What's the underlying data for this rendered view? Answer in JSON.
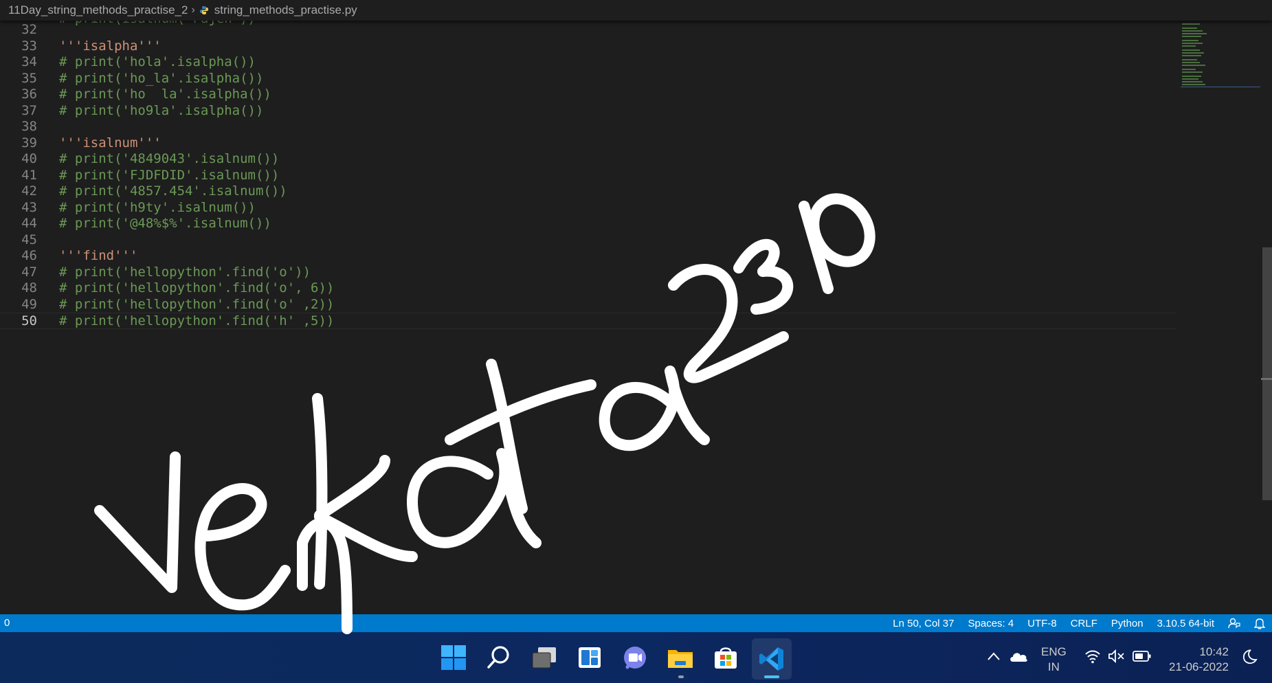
{
  "breadcrumb": {
    "folder": "11Day_string_methods_practise_2",
    "file": "string_methods_practise.py"
  },
  "editor": {
    "partial_line": "# print(isalnum(\"Fajeh\"))",
    "lines": [
      {
        "num": "32",
        "text": "",
        "kind": "plain"
      },
      {
        "num": "33",
        "text": "'''isalpha'''",
        "kind": "docstr"
      },
      {
        "num": "34",
        "text": "# print('hola'.isalpha())",
        "kind": "comment"
      },
      {
        "num": "35",
        "text": "# print('ho_la'.isalpha())",
        "kind": "comment"
      },
      {
        "num": "36",
        "text": "# print('ho  la'.isalpha())",
        "kind": "comment"
      },
      {
        "num": "37",
        "text": "# print('ho9la'.isalpha())",
        "kind": "comment"
      },
      {
        "num": "38",
        "text": "",
        "kind": "plain"
      },
      {
        "num": "39",
        "text": "'''isalnum'''",
        "kind": "docstr"
      },
      {
        "num": "40",
        "text": "# print('4849043'.isalnum())",
        "kind": "comment"
      },
      {
        "num": "41",
        "text": "# print('FJDFDID'.isalnum())",
        "kind": "comment"
      },
      {
        "num": "42",
        "text": "# print('4857.454'.isalnum())",
        "kind": "comment"
      },
      {
        "num": "43",
        "text": "# print('h9ty'.isalnum())",
        "kind": "comment"
      },
      {
        "num": "44",
        "text": "# print('@48%$%'.isalnum())",
        "kind": "comment"
      },
      {
        "num": "45",
        "text": "",
        "kind": "plain"
      },
      {
        "num": "46",
        "text": "'''find'''",
        "kind": "docstr"
      },
      {
        "num": "47",
        "text": "# print('hellopython'.find('o'))",
        "kind": "comment"
      },
      {
        "num": "48",
        "text": "# print('hellopython'.find('o', 6))",
        "kind": "comment"
      },
      {
        "num": "49",
        "text": "# print('hellopython'.find('o' ,2))",
        "kind": "comment"
      },
      {
        "num": "50",
        "text": "# print('hellopython'.find('h' ,5))",
        "kind": "comment",
        "current": true
      }
    ]
  },
  "watermark": {
    "text": "Venkata2310",
    "color": "#ffffff"
  },
  "statusbar": {
    "problems": "0",
    "position": "Ln 50, Col 37",
    "spaces": "Spaces: 4",
    "encoding": "UTF-8",
    "eol": "CRLF",
    "language": "Python",
    "interpreter": "3.10.5 64-bit",
    "icons": [
      "feedback-icon",
      "bell-icon"
    ],
    "color": "#007acc"
  },
  "taskbar": {
    "apps": [
      "windows-start-icon",
      "search-icon",
      "task-view-icon",
      "widgets-icon",
      "teams-chat-icon",
      "file-explorer-icon",
      "microsoft-store-icon",
      "vscode-icon"
    ],
    "active_app": "vscode-icon",
    "tray_icons": [
      "chevron-up-icon",
      "onedrive-cloud-icon",
      "wifi-icon",
      "volume-muted-icon",
      "battery-icon",
      "focus-moon-icon"
    ],
    "lang_line1": "ENG",
    "lang_line2": "IN",
    "time": "10:42",
    "date": "21-06-2022"
  }
}
